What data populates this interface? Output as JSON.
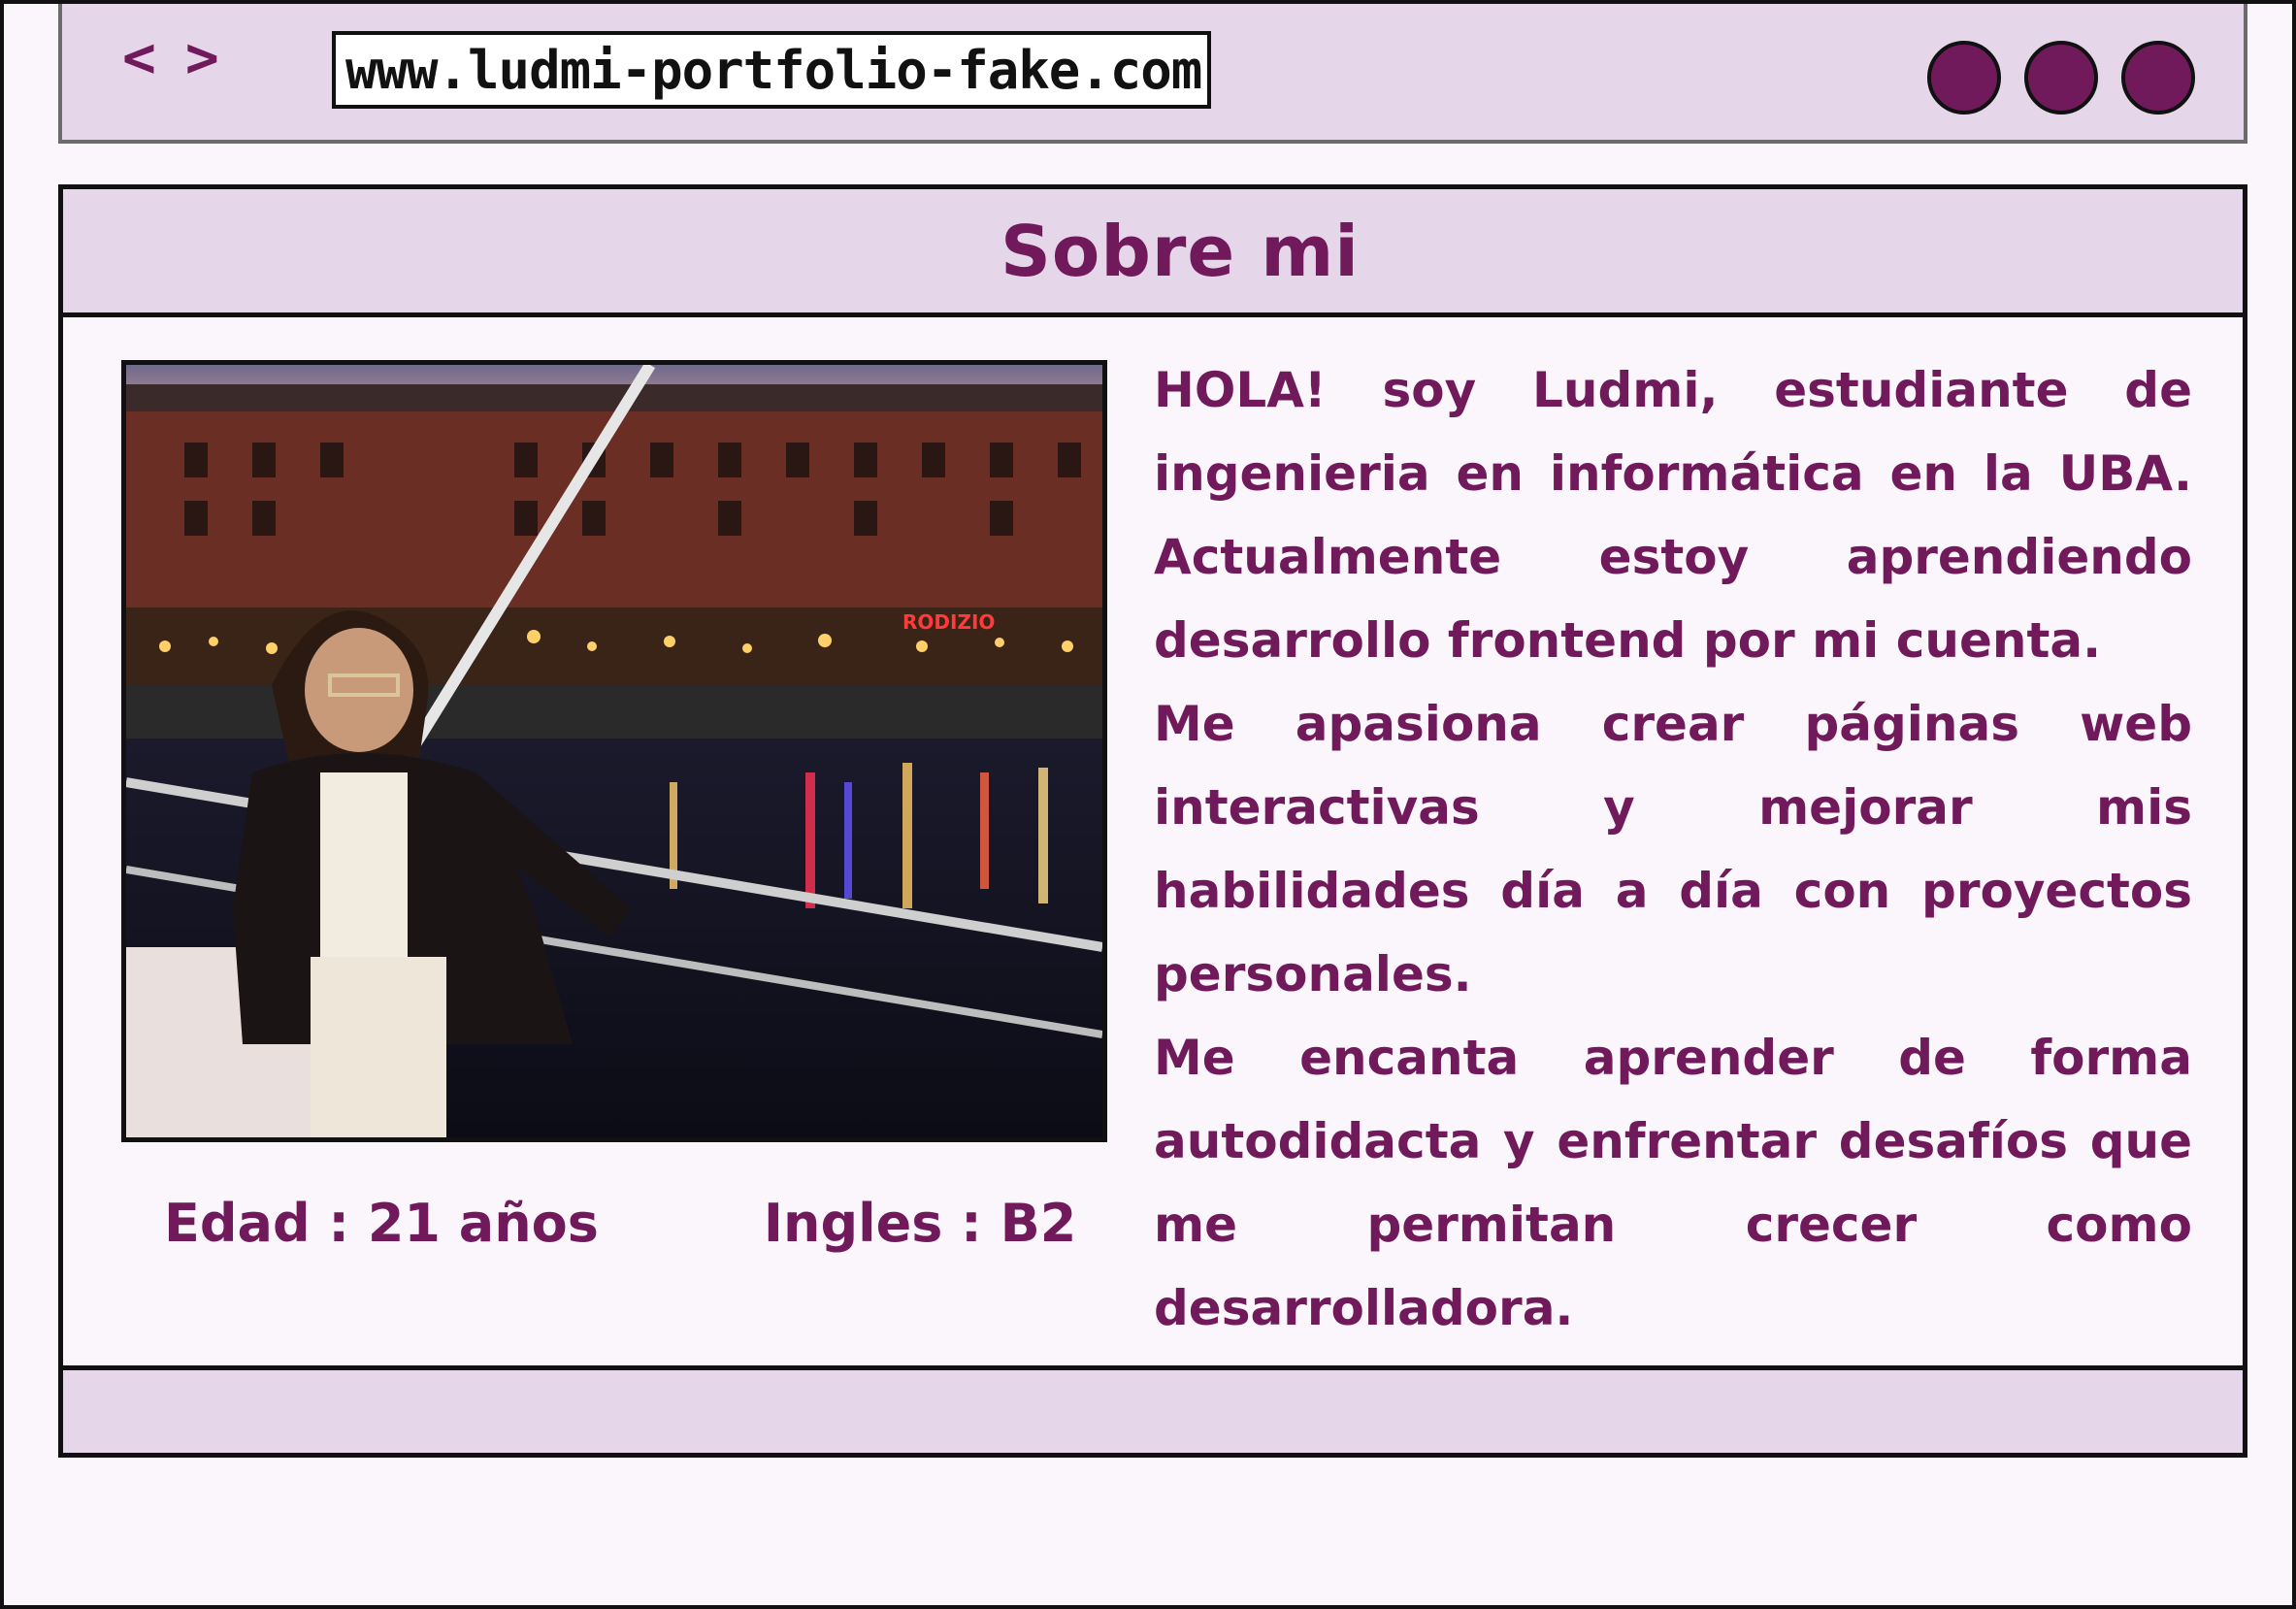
{
  "browser": {
    "back_label": "<",
    "forward_label": ">",
    "url": "www.ludmi-portfolio-fake.com",
    "window_controls": [
      "control-dot-1",
      "control-dot-2",
      "control-dot-3"
    ]
  },
  "section": {
    "title": "Sobre mi",
    "photo_alt": "Foto de Ludmi en un puerto de noche",
    "stats": {
      "age": "Edad : 21 años",
      "english": "Ingles : B2"
    },
    "paragraphs": [
      "HOLA! soy Ludmi, estudiante de ingenieria en informática en la UBA. Actualmente estoy aprendiendo desarrollo frontend por mi cuenta.",
      "Me apasiona crear páginas web interactivas y mejorar mis habilidades día a día con proyectos personales.",
      "Me encanta aprender de forma autodidacta y enfrentar desafíos que me permitan crecer como desarrolladora."
    ]
  },
  "photo_sign": "RODIZIO",
  "colors": {
    "accent": "#701a5c",
    "panel": "#e6d6ea",
    "background": "#fbf6fb"
  }
}
